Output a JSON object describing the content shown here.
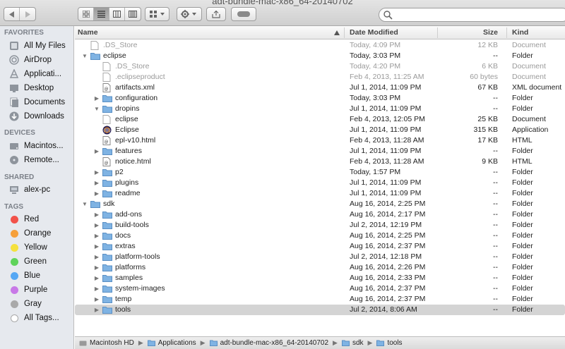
{
  "window": {
    "title": "adt-bundle-mac-x86_64-20140702"
  },
  "toolbar": {
    "back_icon": "back-arrow-icon",
    "forward_icon": "forward-arrow-icon",
    "views": [
      "icon-view",
      "list-view",
      "column-view",
      "coverflow-view"
    ],
    "arrange_icon": "arrange-grid-icon",
    "action_icon": "gear-icon",
    "share_icon": "share-icon",
    "tags_icon": "tag-pill-icon",
    "search_placeholder": ""
  },
  "sidebar": {
    "favorites_heading": "FAVORITES",
    "favorites": [
      {
        "label": "All My Files",
        "icon": "all-files-icon"
      },
      {
        "label": "AirDrop",
        "icon": "airdrop-icon"
      },
      {
        "label": "Applicati...",
        "icon": "applications-icon"
      },
      {
        "label": "Desktop",
        "icon": "desktop-icon"
      },
      {
        "label": "Documents",
        "icon": "documents-icon"
      },
      {
        "label": "Downloads",
        "icon": "downloads-icon"
      }
    ],
    "devices_heading": "DEVICES",
    "devices": [
      {
        "label": "Macintos...",
        "icon": "hard-disk-icon"
      },
      {
        "label": "Remote...",
        "icon": "remote-disc-icon"
      }
    ],
    "shared_heading": "SHARED",
    "shared": [
      {
        "label": "alex-pc",
        "icon": "pc-monitor-icon"
      }
    ],
    "tags_heading": "TAGS",
    "tags": [
      {
        "label": "Red",
        "color": "#f2524a"
      },
      {
        "label": "Orange",
        "color": "#f6a03b"
      },
      {
        "label": "Yellow",
        "color": "#f5e13e"
      },
      {
        "label": "Green",
        "color": "#5fd35a"
      },
      {
        "label": "Blue",
        "color": "#55a7f4"
      },
      {
        "label": "Purple",
        "color": "#c879e7"
      },
      {
        "label": "Gray",
        "color": "#a9a9a9"
      },
      {
        "label": "All Tags...",
        "color": "#ffffff"
      }
    ]
  },
  "columns": {
    "name": "Name",
    "date": "Date Modified",
    "size": "Size",
    "kind": "Kind",
    "sort_icon": "sort-ascending-icon"
  },
  "files": [
    {
      "name": ".DS_Store",
      "date": "Today, 4:09 PM",
      "size": "12 KB",
      "kind": "Document",
      "level": 0,
      "type": "doc",
      "disclosure": "none",
      "dimmed": true
    },
    {
      "name": "eclipse",
      "date": "Today, 3:03 PM",
      "size": "--",
      "kind": "Folder",
      "level": 0,
      "type": "folder",
      "disclosure": "open",
      "dimmed": false
    },
    {
      "name": ".DS_Store",
      "date": "Today, 4:20 PM",
      "size": "6 KB",
      "kind": "Document",
      "level": 1,
      "type": "doc",
      "disclosure": "none",
      "dimmed": true
    },
    {
      "name": ".eclipseproduct",
      "date": "Feb 4, 2013, 11:25 AM",
      "size": "60 bytes",
      "kind": "Document",
      "level": 1,
      "type": "doc",
      "disclosure": "none",
      "dimmed": true
    },
    {
      "name": "artifacts.xml",
      "date": "Jul 1, 2014, 11:09 PM",
      "size": "67 KB",
      "kind": "XML document",
      "level": 1,
      "type": "xml",
      "disclosure": "none",
      "dimmed": false
    },
    {
      "name": "configuration",
      "date": "Today, 3:03 PM",
      "size": "--",
      "kind": "Folder",
      "level": 1,
      "type": "folder",
      "disclosure": "closed",
      "dimmed": false
    },
    {
      "name": "dropins",
      "date": "Jul 1, 2014, 11:09 PM",
      "size": "--",
      "kind": "Folder",
      "level": 1,
      "type": "folder",
      "disclosure": "open",
      "dimmed": false
    },
    {
      "name": "eclipse",
      "date": "Feb 4, 2013, 12:05 PM",
      "size": "25 KB",
      "kind": "Document",
      "level": 1,
      "type": "doc",
      "disclosure": "none",
      "dimmed": false
    },
    {
      "name": "Eclipse",
      "date": "Jul 1, 2014, 11:09 PM",
      "size": "315 KB",
      "kind": "Application",
      "level": 1,
      "type": "app",
      "disclosure": "none",
      "dimmed": false
    },
    {
      "name": "epl-v10.html",
      "date": "Feb 4, 2013, 11:28 AM",
      "size": "17 KB",
      "kind": "HTML",
      "level": 1,
      "type": "html",
      "disclosure": "none",
      "dimmed": false
    },
    {
      "name": "features",
      "date": "Jul 1, 2014, 11:09 PM",
      "size": "--",
      "kind": "Folder",
      "level": 1,
      "type": "folder",
      "disclosure": "closed",
      "dimmed": false
    },
    {
      "name": "notice.html",
      "date": "Feb 4, 2013, 11:28 AM",
      "size": "9 KB",
      "kind": "HTML",
      "level": 1,
      "type": "html",
      "disclosure": "none",
      "dimmed": false
    },
    {
      "name": "p2",
      "date": "Today, 1:57 PM",
      "size": "--",
      "kind": "Folder",
      "level": 1,
      "type": "folder",
      "disclosure": "closed",
      "dimmed": false
    },
    {
      "name": "plugins",
      "date": "Jul 1, 2014, 11:09 PM",
      "size": "--",
      "kind": "Folder",
      "level": 1,
      "type": "folder",
      "disclosure": "closed",
      "dimmed": false
    },
    {
      "name": "readme",
      "date": "Jul 1, 2014, 11:09 PM",
      "size": "--",
      "kind": "Folder",
      "level": 1,
      "type": "folder",
      "disclosure": "closed",
      "dimmed": false
    },
    {
      "name": "sdk",
      "date": "Aug 16, 2014, 2:25 PM",
      "size": "--",
      "kind": "Folder",
      "level": 0,
      "type": "folder",
      "disclosure": "open",
      "dimmed": false
    },
    {
      "name": "add-ons",
      "date": "Aug 16, 2014, 2:17 PM",
      "size": "--",
      "kind": "Folder",
      "level": 1,
      "type": "folder",
      "disclosure": "closed",
      "dimmed": false
    },
    {
      "name": "build-tools",
      "date": "Jul 2, 2014, 12:19 PM",
      "size": "--",
      "kind": "Folder",
      "level": 1,
      "type": "folder",
      "disclosure": "closed",
      "dimmed": false
    },
    {
      "name": "docs",
      "date": "Aug 16, 2014, 2:25 PM",
      "size": "--",
      "kind": "Folder",
      "level": 1,
      "type": "folder",
      "disclosure": "closed",
      "dimmed": false
    },
    {
      "name": "extras",
      "date": "Aug 16, 2014, 2:37 PM",
      "size": "--",
      "kind": "Folder",
      "level": 1,
      "type": "folder",
      "disclosure": "closed",
      "dimmed": false
    },
    {
      "name": "platform-tools",
      "date": "Jul 2, 2014, 12:18 PM",
      "size": "--",
      "kind": "Folder",
      "level": 1,
      "type": "folder",
      "disclosure": "closed",
      "dimmed": false
    },
    {
      "name": "platforms",
      "date": "Aug 16, 2014, 2:26 PM",
      "size": "--",
      "kind": "Folder",
      "level": 1,
      "type": "folder",
      "disclosure": "closed",
      "dimmed": false
    },
    {
      "name": "samples",
      "date": "Aug 16, 2014, 2:33 PM",
      "size": "--",
      "kind": "Folder",
      "level": 1,
      "type": "folder",
      "disclosure": "closed",
      "dimmed": false
    },
    {
      "name": "system-images",
      "date": "Aug 16, 2014, 2:37 PM",
      "size": "--",
      "kind": "Folder",
      "level": 1,
      "type": "folder",
      "disclosure": "closed",
      "dimmed": false
    },
    {
      "name": "temp",
      "date": "Aug 16, 2014, 2:37 PM",
      "size": "--",
      "kind": "Folder",
      "level": 1,
      "type": "folder",
      "disclosure": "closed",
      "dimmed": false
    },
    {
      "name": "tools",
      "date": "Jul 2, 2014, 8:06 AM",
      "size": "--",
      "kind": "Folder",
      "level": 1,
      "type": "folder",
      "disclosure": "closed",
      "dimmed": false,
      "selected": true
    }
  ],
  "pathbar": [
    {
      "label": "Macintosh HD",
      "icon": "hard-disk-icon"
    },
    {
      "label": "Applications",
      "icon": "folder-icon"
    },
    {
      "label": "adt-bundle-mac-x86_64-20140702",
      "icon": "folder-icon"
    },
    {
      "label": "sdk",
      "icon": "folder-icon"
    },
    {
      "label": "tools",
      "icon": "folder-icon"
    }
  ],
  "colors": {
    "folder": "#7fb3e3",
    "selection": "#d4d4d4",
    "sidebar_bg": "#e6e9ee"
  }
}
